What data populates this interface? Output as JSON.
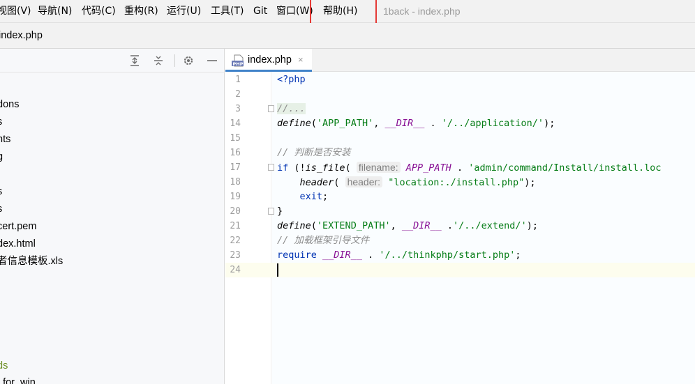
{
  "menu": [
    {
      "label": "视图(V)",
      "name": "menu-view"
    },
    {
      "label": "导航(N)",
      "name": "menu-navigate"
    },
    {
      "label": "代码(C)",
      "name": "menu-code"
    },
    {
      "label": "重构(R)",
      "name": "menu-refactor"
    },
    {
      "label": "运行(U)",
      "name": "menu-run"
    },
    {
      "label": "工具(T)",
      "name": "menu-tools"
    },
    {
      "label": "Git",
      "name": "menu-git"
    },
    {
      "label": "窗口(W)",
      "name": "menu-window"
    },
    {
      "label": "帮助(H)",
      "name": "menu-help"
    }
  ],
  "window_title": "1back - index.php",
  "nav": {
    "file": "index.php"
  },
  "project_tree": [
    "dons",
    "s",
    "nts",
    "g",
    "",
    "s",
    "s",
    "cert.pem",
    "dex.html",
    "者信息模板.xls",
    "ds",
    "_for_win"
  ],
  "editor": {
    "tab_label": "index.php",
    "tab_close": "×",
    "icon": "php-file-icon"
  },
  "code_lines": [
    {
      "n": "1",
      "html_parts": [
        {
          "t": "<?php",
          "c": "kw"
        }
      ]
    },
    {
      "n": "2",
      "html_parts": []
    },
    {
      "n": "3",
      "html_parts": [
        {
          "t": "//...",
          "c": "fold-bg"
        }
      ]
    },
    {
      "n": "14",
      "html_parts": [
        {
          "t": "define",
          "c": "fn"
        },
        {
          "t": "(",
          "c": ""
        },
        {
          "t": "'APP_PATH'",
          "c": "str"
        },
        {
          "t": ", ",
          "c": ""
        },
        {
          "t": "__DIR__",
          "c": "magic"
        },
        {
          "t": " . ",
          "c": ""
        },
        {
          "t": "'/../application/'",
          "c": "str"
        },
        {
          "t": ");",
          "c": ""
        }
      ]
    },
    {
      "n": "15",
      "html_parts": []
    },
    {
      "n": "16",
      "html_parts": [
        {
          "t": "// 判断是否安装",
          "c": "cm"
        }
      ]
    },
    {
      "n": "17",
      "html_parts": [
        {
          "t": "if",
          "c": "kw"
        },
        {
          "t": " (!",
          "c": ""
        },
        {
          "t": "is_file",
          "c": "fn"
        },
        {
          "t": "( ",
          "c": ""
        },
        {
          "t": "filename:",
          "c": "hint"
        },
        {
          "t": " ",
          "c": ""
        },
        {
          "t": "APP_PATH",
          "c": "constc"
        },
        {
          "t": " . ",
          "c": ""
        },
        {
          "t": "'admin/command/Install/install.loc",
          "c": "str"
        }
      ]
    },
    {
      "n": "18",
      "html_parts": [
        {
          "t": "    ",
          "c": ""
        },
        {
          "t": "header",
          "c": "fn"
        },
        {
          "t": "( ",
          "c": ""
        },
        {
          "t": "header:",
          "c": "hint"
        },
        {
          "t": " ",
          "c": ""
        },
        {
          "t": "\"location:./install.php\"",
          "c": "str"
        },
        {
          "t": ");",
          "c": ""
        }
      ]
    },
    {
      "n": "19",
      "html_parts": [
        {
          "t": "    ",
          "c": ""
        },
        {
          "t": "exit",
          "c": "kw"
        },
        {
          "t": ";",
          "c": ""
        }
      ]
    },
    {
      "n": "20",
      "html_parts": [
        {
          "t": "}",
          "c": ""
        }
      ]
    },
    {
      "n": "21",
      "html_parts": [
        {
          "t": "define",
          "c": "fn"
        },
        {
          "t": "(",
          "c": ""
        },
        {
          "t": "'EXTEND_PATH'",
          "c": "str"
        },
        {
          "t": ", ",
          "c": ""
        },
        {
          "t": "__DIR__",
          "c": "magic"
        },
        {
          "t": " .",
          "c": ""
        },
        {
          "t": "'/../extend/'",
          "c": "str"
        },
        {
          "t": ");",
          "c": ""
        }
      ]
    },
    {
      "n": "22",
      "html_parts": [
        {
          "t": "// 加载框架引导文件",
          "c": "cm"
        }
      ]
    },
    {
      "n": "23",
      "html_parts": [
        {
          "t": "require",
          "c": "kw"
        },
        {
          "t": " ",
          "c": ""
        },
        {
          "t": "__DIR__",
          "c": "magic"
        },
        {
          "t": " . ",
          "c": ""
        },
        {
          "t": "'/../thinkphp/start.php'",
          "c": "str"
        },
        {
          "t": ";",
          "c": ""
        }
      ]
    },
    {
      "n": "24",
      "html_parts": []
    }
  ],
  "toolbar_icons": [
    "expand-all-icon",
    "collapse-all-icon",
    "gear-icon",
    "minimize-icon"
  ]
}
